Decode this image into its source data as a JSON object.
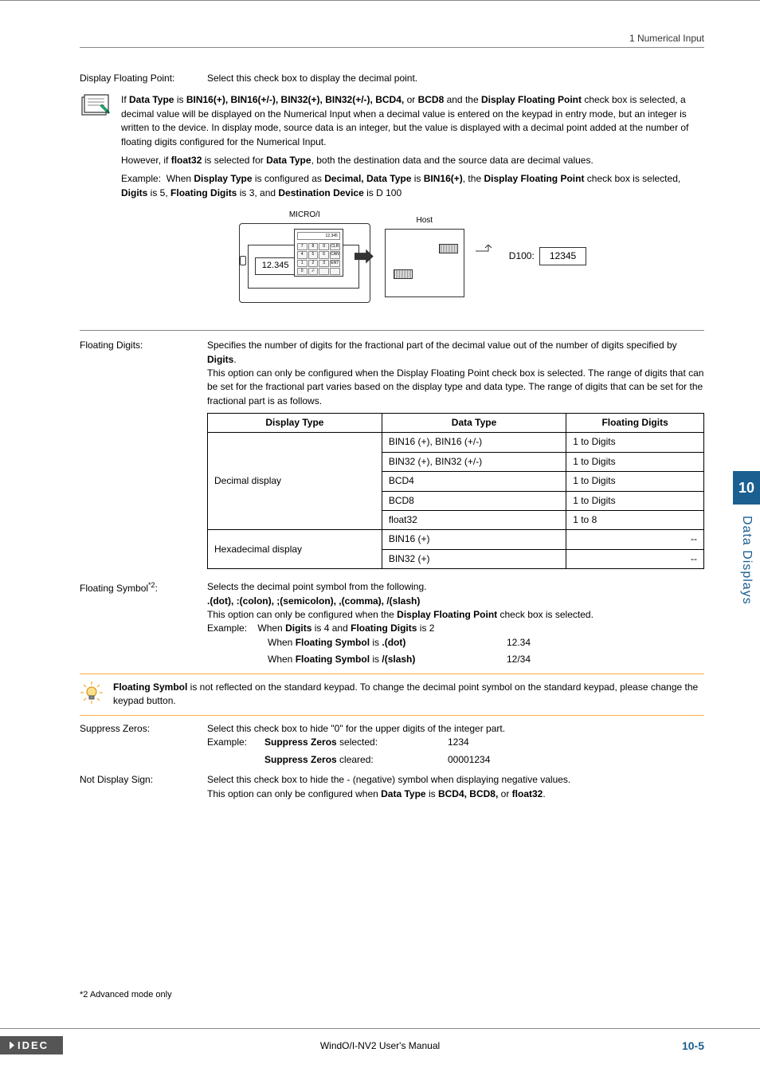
{
  "header": {
    "section": "1 Numerical Input"
  },
  "sidebar": {
    "chapter_num": "10",
    "chapter_title": "Data Displays"
  },
  "labels": {
    "display_floating_point": "Display Floating Point:",
    "floating_digits": "Floating Digits:",
    "floating_symbol": "Floating Symbol",
    "suppress_zeros": "Suppress Zeros:",
    "not_display_sign": "Not Display Sign:",
    "example": "Example:"
  },
  "display_floating_point_desc": "Select this check box to display the decimal point.",
  "note1": {
    "p1a": "If ",
    "p1b": "Data Type",
    "p1c": " is ",
    "types": "BIN16(+), BIN16(+/-), BIN32(+), BIN32(+/-), BCD4,",
    "p1or": " or ",
    "p1bcd8": "BCD8",
    "p1and": " and the ",
    "p1dfp": "Display Floating Point",
    "p1rest": " check box is selected, a decimal value will be displayed on the Numerical Input when a decimal value is entered on the keypad in entry mode, but an integer is written to the device. In display mode, source data is an integer, but the value is displayed with a decimal point added at the number of floating digits configured for the Numerical Input.",
    "p2a": "However, if ",
    "p2b": "float32",
    "p2c": " is selected for ",
    "p2d": "Data Type",
    "p2e": ", both the destination data and the source data are decimal values.",
    "p3a": "When ",
    "p3b": "Display Type",
    "p3c": " is configured as ",
    "p3d": "Decimal, Data Type",
    "p3e": " is ",
    "p3f": "BIN16(+)",
    "p3g": ", the ",
    "p3h": "Display Floating Point",
    "p3i": " check box is selected, ",
    "p3j": "Digits",
    "p3k": " is 5, ",
    "p3l": "Floating Digits",
    "p3m": " is 3, and ",
    "p3n": "Destination Device",
    "p3o": " is D 100"
  },
  "diagram": {
    "microi_label": "MICRO/I",
    "microi_value": "12.345",
    "keypad_display": "12.345",
    "host_label": "Host",
    "d_label": "D100:",
    "d_value": "12345",
    "keys": [
      "7",
      "8",
      "9",
      "CLR",
      "4",
      "5",
      "6",
      "CAN",
      "1",
      "2",
      "3",
      "ENT",
      "0",
      "./-",
      "",
      ""
    ]
  },
  "floating_digits_desc": {
    "p1a": "Specifies the number of digits for the fractional part of the decimal value out of the number of digits specified by ",
    "p1b": "Digits",
    "p1c": ".",
    "p2": "This option can only be configured when the Display Floating Point check box is selected. The range of digits that can be set for the fractional part varies based on the display type and data type. The range of digits that can be set for the fractional part is as follows."
  },
  "table": {
    "headers": {
      "c1": "Display Type",
      "c2": "Data Type",
      "c3": "Floating Digits"
    },
    "rows": [
      {
        "display": "Decimal display",
        "data": "BIN16 (+), BIN16 (+/-)",
        "digits": "1 to Digits"
      },
      {
        "display": "",
        "data": "BIN32 (+), BIN32 (+/-)",
        "digits": "1 to Digits"
      },
      {
        "display": "",
        "data": "BCD4",
        "digits": "1 to Digits"
      },
      {
        "display": "",
        "data": "BCD8",
        "digits": "1 to Digits"
      },
      {
        "display": "",
        "data": "float32",
        "digits": "1 to 8"
      },
      {
        "display": "Hexadecimal display",
        "data": "BIN16 (+)",
        "digits": "--"
      },
      {
        "display": "",
        "data": "BIN32 (+)",
        "digits": "--"
      }
    ]
  },
  "floating_symbol": {
    "sup": "*2",
    "colon": ":",
    "p1": "Selects the decimal point symbol from the following.",
    "symbols": ".(dot), :(colon), ;(semicolon), ,(comma), /(slash)",
    "p2a": "This option can only be configured when the ",
    "p2b": "Display Floating Point",
    "p2c": " check box is selected.",
    "ex0a": "When ",
    "ex0b": "Digits",
    "ex0c": " is 4 and ",
    "ex0d": "Floating Digits",
    "ex0e": " is 2",
    "ex1a": "When ",
    "ex1b": "Floating Symbol",
    "ex1c": " is ",
    "ex1d": ".(dot)",
    "ex1v": "12.34",
    "ex2a": "When ",
    "ex2b": "Floating Symbol",
    "ex2c": " is ",
    "ex2d": "/(slash)",
    "ex2v": "12/34"
  },
  "bulb": {
    "p1a": "Floating Symbol",
    "p1b": " is not reflected on the standard keypad. To change the decimal point symbol on the standard keypad, please change the keypad button."
  },
  "suppress_zeros": {
    "desc": "Select this check box to hide \"0\" for the upper digits of the integer part.",
    "ex1a": "Suppress Zeros",
    "ex1b": " selected:",
    "ex1v": "1234",
    "ex2a": "Suppress Zeros",
    "ex2b": " cleared:",
    "ex2v": "00001234"
  },
  "not_display_sign": {
    "p1": "Select this check box to hide the - (negative) symbol when displaying negative values.",
    "p2a": "This option can only be configured when ",
    "p2b": "Data Type",
    "p2c": " is ",
    "p2d": "BCD4, BCD8,",
    "p2e": " or ",
    "p2f": "float32",
    "p2g": "."
  },
  "footnote": "*2  Advanced mode only",
  "footer": {
    "brand": "IDEC",
    "center": "WindO/I-NV2 User's Manual",
    "page": "10-5"
  }
}
